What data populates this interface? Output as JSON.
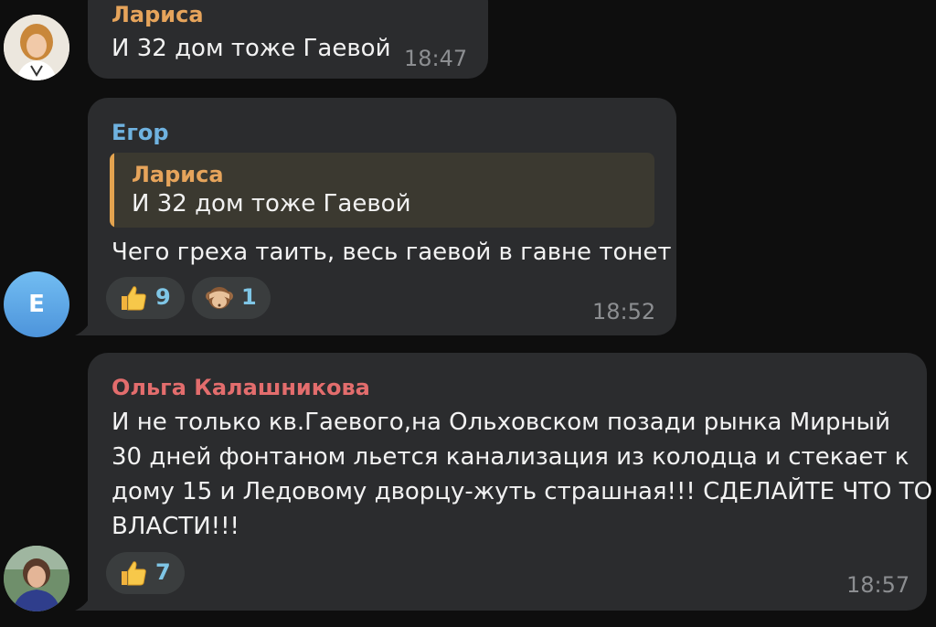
{
  "colors": {
    "background": "#0e0e0e",
    "bubble": "#2b2c2e",
    "author_larisa": "#e6a45b",
    "author_egor": "#6fb2e0",
    "author_olga": "#e36d6d",
    "reply_bar": "#e3a34f",
    "reaction_count": "#7fc6e6",
    "timestamp": "#8c8e91"
  },
  "messages": [
    {
      "author": "Лариса",
      "avatar_icon": "user-photo-avatar",
      "text": "И 32 дом тоже Гаевой",
      "time": "18:47"
    },
    {
      "author": "Егор",
      "avatar_initial": "Е",
      "reply": {
        "author": "Лариса",
        "text": "И 32 дом тоже Гаевой"
      },
      "text": "Чего греха таить, весь гаевой в гавне тонет",
      "reactions": [
        {
          "emoji": "thumbs-up",
          "count": "9"
        },
        {
          "emoji": "see-no-evil-monkey",
          "count": "1"
        }
      ],
      "time": "18:52"
    },
    {
      "author": "Ольга Калашникова",
      "avatar_icon": "user-photo-avatar",
      "lines": [
        "И не только кв.Гаевого,на Ольховском позади рынка Мирный",
        "30 дней фонтаном льется канализация из колодца и стекает к",
        "дому 15 и Ледовому дворцу-жуть страшная!!! СДЕЛАЙТЕ ЧТО ТО",
        "ВЛАСТИ!!!"
      ],
      "reactions": [
        {
          "emoji": "thumbs-up",
          "count": "7"
        }
      ],
      "time": "18:57"
    }
  ]
}
